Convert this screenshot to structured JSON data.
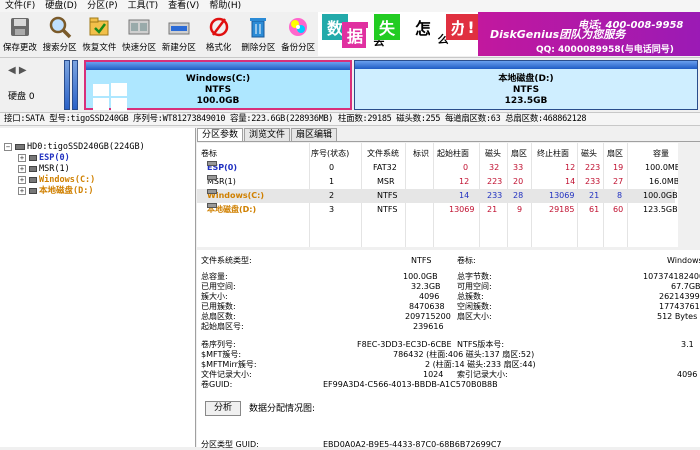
{
  "menu": [
    "文件(F)",
    "硬盘(D)",
    "分区(P)",
    "工具(T)",
    "查看(V)",
    "帮助(H)"
  ],
  "toolbar": [
    {
      "label": "保存更改",
      "icon": "save-icon"
    },
    {
      "label": "搜索分区",
      "icon": "search-icon"
    },
    {
      "label": "恢复文件",
      "icon": "recover-icon"
    },
    {
      "label": "快速分区",
      "icon": "quick-partition-icon"
    },
    {
      "label": "新建分区",
      "icon": "new-partition-icon"
    },
    {
      "label": "格式化",
      "icon": "format-icon"
    },
    {
      "label": "删除分区",
      "icon": "delete-icon"
    },
    {
      "label": "备份分区",
      "icon": "backup-icon"
    }
  ],
  "banner": {
    "tiles": [
      "数",
      "据",
      "丢",
      "失",
      "怎",
      "么",
      "办",
      "!"
    ],
    "brand": "DiskGenius团队为您服务",
    "tel": "电话: 400-008-9958",
    "qq": "QQ: 4000089958(与电话同号)"
  },
  "disk": {
    "label": "硬盘 0",
    "partitions": [
      {
        "name": "Windows(C:)",
        "fs": "NTFS",
        "size": "100.0GB"
      },
      {
        "name": "本地磁盘(D:)",
        "fs": "NTFS",
        "size": "123.5GB"
      }
    ]
  },
  "infoline": "接口:SATA  型号:tigoSSD240GB  序列号:WT81273849010  容量:223.6GB(228936MB)  柱面数:29185  磁头数:255  每道扇区数:63  总扇区数:468862128",
  "tree": {
    "root": "HD0:tigoSSD240GB(224GB)",
    "items": [
      {
        "label": "ESP(0)",
        "color": "#2030c0"
      },
      {
        "label": "MSR(1)",
        "color": "#000000"
      },
      {
        "label": "Windows(C:)",
        "color": "#d08000"
      },
      {
        "label": "本地磁盘(D:)",
        "color": "#d08000"
      }
    ]
  },
  "tabs": [
    "分区参数",
    "浏览文件",
    "扇区编辑"
  ],
  "table": {
    "headers": [
      "卷标",
      "序号(状态)",
      "文件系统",
      "标识",
      "起始柱面",
      "磁头",
      "扇区",
      "终止柱面",
      "磁头",
      "扇区",
      "容量"
    ],
    "rows": [
      {
        "name": "ESP(0)",
        "num": "0",
        "fs": "FAT32",
        "id": "",
        "sc": "0",
        "sh": "32",
        "ss": "33",
        "ec": "12",
        "eh": "223",
        "es": "19",
        "cap": "100.0MB"
      },
      {
        "name": "MSR(1)",
        "num": "1",
        "fs": "MSR",
        "id": "",
        "sc": "12",
        "sh": "223",
        "ss": "20",
        "ec": "14",
        "eh": "233",
        "es": "27",
        "cap": "16.0MB"
      },
      {
        "name": "Windows(C:)",
        "num": "2",
        "fs": "NTFS",
        "id": "",
        "sc": "14",
        "sh": "233",
        "ss": "28",
        "ec": "13069",
        "eh": "21",
        "es": "8",
        "cap": "100.0GB"
      },
      {
        "name": "本地磁盘(D:)",
        "num": "3",
        "fs": "NTFS",
        "id": "",
        "sc": "13069",
        "sh": "21",
        "ss": "9",
        "ec": "29185",
        "eh": "61",
        "es": "60",
        "cap": "123.5GB"
      }
    ]
  },
  "details": {
    "fs_type_label": "文件系统类型:",
    "fs_type": "NTFS",
    "vol_label_label": "卷标:",
    "vol_label": "Windows",
    "left": [
      [
        "总容量:",
        "100.0GB"
      ],
      [
        "已用空间:",
        "32.3GB"
      ],
      [
        "簇大小:",
        "4096"
      ],
      [
        "已用簇数:",
        "8470638"
      ],
      [
        "总扇区数:",
        "209715200"
      ],
      [
        "起始扇区号:",
        "239616"
      ]
    ],
    "right": [
      [
        "总字节数:",
        "107374182400"
      ],
      [
        "可用空间:",
        "67.7GB"
      ],
      [
        "总簇数:",
        "26214399"
      ],
      [
        "空闲簇数:",
        "17743761"
      ],
      [
        "扇区大小:",
        "512 Bytes"
      ]
    ],
    "serial_label": "卷序列号:",
    "serial": "F8EC-3DD3-EC3D-6CBE",
    "ntfs_ver_label": "NTFS版本号:",
    "ntfs_ver": "3.1",
    "mft_label": "$MFT簇号:",
    "mft": "786432 (柱面:406 磁头:137 扇区:52)",
    "mftmirr_label": "$MFTMirr簇号:",
    "mftmirr": "2 (柱面:14 磁头:233 扇区:44)",
    "rec_label": "文件记录大小:",
    "rec": "1024",
    "idx_label": "索引记录大小:",
    "idx": "4096",
    "guid_label": "卷GUID:",
    "guid": "EF99A3D4-C566-4013-BBDB-A1C570B0B8B",
    "analyze": "分析",
    "alloc_label": "数据分配情况图:",
    "bottom_label": "分区类型 GUID:",
    "bottom_val": "EBD0A0A2-B9E5-4433-87C0-68B6B72699C7"
  }
}
